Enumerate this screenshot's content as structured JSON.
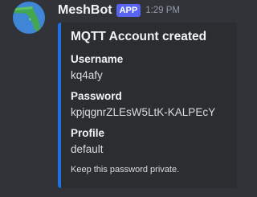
{
  "message": {
    "author": "MeshBot",
    "app_tag": "APP",
    "timestamp": "1:29 PM",
    "avatar_icon": "florida-map-icon"
  },
  "embed": {
    "accent_color": "#1f6fe5",
    "title": "MQTT Account created",
    "fields": [
      {
        "name": "Username",
        "value": "kq4afy"
      },
      {
        "name": "Password",
        "value": "kpjqgnrZLEsW5LtK-KALPEcY"
      },
      {
        "name": "Profile",
        "value": "default"
      }
    ],
    "footer": "Keep this password private."
  }
}
